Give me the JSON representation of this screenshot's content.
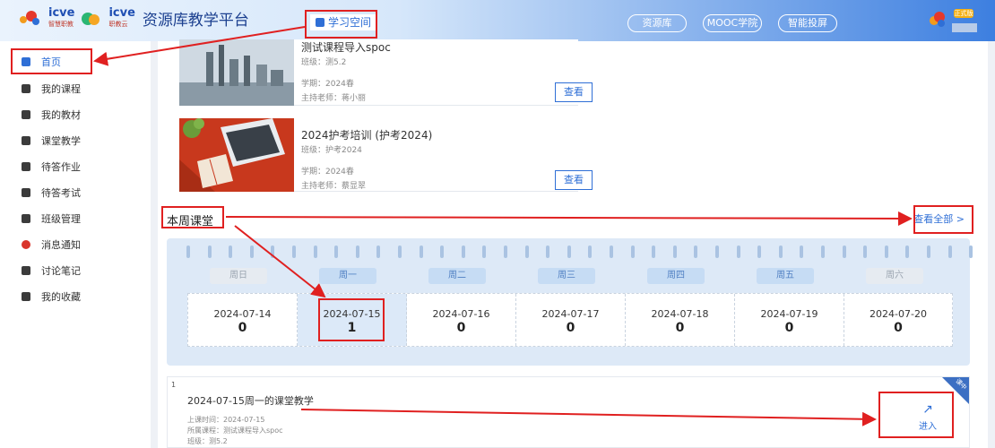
{
  "header": {
    "logo_primary": "icve",
    "logo_primary_sub": "智慧职教",
    "logo_secondary": "icve",
    "logo_secondary_sub": "职教云",
    "platform_title": "资源库教学平台",
    "study_space_label": "学习空间",
    "nav": [
      "资源库",
      "MOOC学院",
      "智能投屏"
    ],
    "user_badge": "正式版"
  },
  "sidebar": {
    "items": [
      {
        "label": "首页",
        "icon": "home-icon",
        "active": true
      },
      {
        "label": "我的课程",
        "icon": "books-icon"
      },
      {
        "label": "我的教材",
        "icon": "textbook-icon"
      },
      {
        "label": "课堂教学",
        "icon": "class-icon"
      },
      {
        "label": "待答作业",
        "icon": "homework-icon"
      },
      {
        "label": "待答考试",
        "icon": "exam-icon"
      },
      {
        "label": "班级管理",
        "icon": "class-manage-icon"
      },
      {
        "label": "消息通知",
        "icon": "bell-icon"
      },
      {
        "label": "讨论笔记",
        "icon": "note-icon"
      },
      {
        "label": "我的收藏",
        "icon": "folder-icon"
      }
    ]
  },
  "courses": [
    {
      "title": "测试课程导入spoc",
      "class": "班级：测5.2",
      "term": "学期：2024春",
      "teacher": "主持老师：蒋小丽",
      "button": "查看"
    },
    {
      "title": "2024护考培训 (护考2024)",
      "class": "班级：护考2024",
      "term": "学期：2024春",
      "teacher": "主持老师：蔡显翠",
      "button": "查看"
    }
  ],
  "week": {
    "title": "本周课堂",
    "view_all": "查看全部 >",
    "days": [
      {
        "name": "周日",
        "date": "2024-07-14",
        "count": "0",
        "weekend": true
      },
      {
        "name": "周一",
        "date": "2024-07-15",
        "count": "1",
        "today": true
      },
      {
        "name": "周二",
        "date": "2024-07-16",
        "count": "0"
      },
      {
        "name": "周三",
        "date": "2024-07-17",
        "count": "0"
      },
      {
        "name": "周四",
        "date": "2024-07-18",
        "count": "0"
      },
      {
        "name": "周五",
        "date": "2024-07-19",
        "count": "0"
      },
      {
        "name": "周六",
        "date": "2024-07-20",
        "count": "0",
        "weekend": true
      }
    ]
  },
  "lesson": {
    "index": "1",
    "title": "2024-07-15周一的课堂教学",
    "time": "上课时间：2024-07-15",
    "course": "所属课程：测试课程导入spoc",
    "class": "班级：测5.2",
    "enter": "进入",
    "corner": "课中"
  },
  "colors": {
    "accent": "#2f6fd6",
    "annotation": "#e02020"
  }
}
